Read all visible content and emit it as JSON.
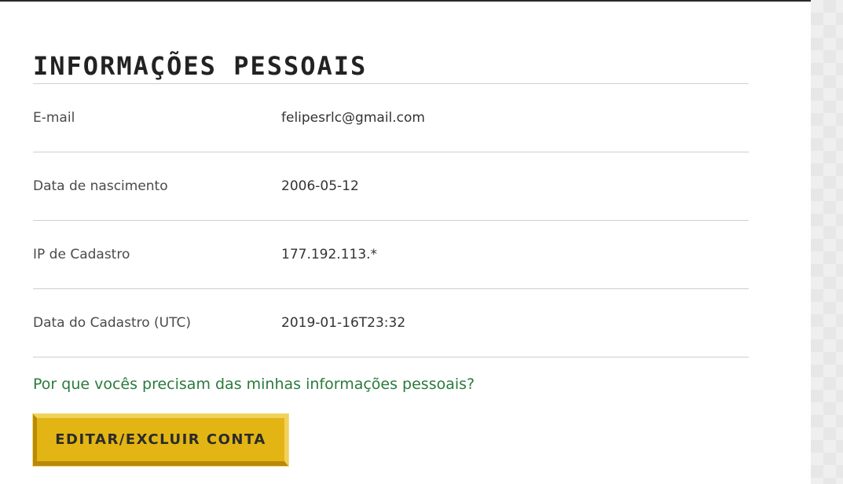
{
  "section": {
    "title": "Informações pessoais"
  },
  "info_rows": [
    {
      "label": "E-mail",
      "value": "felipesrlc@gmail.com"
    },
    {
      "label": "Data de nascimento",
      "value": "2006-05-12"
    },
    {
      "label": "IP de Cadastro",
      "value": "177.192.113.*"
    },
    {
      "label": "Data do Cadastro (UTC)",
      "value": "2019-01-16T23:32"
    }
  ],
  "why_link": {
    "text": "Por que vocês precisam das minhas informações pessoais?"
  },
  "edit_button": {
    "label": "EDITAR/EXCLUIR CONTA"
  },
  "colors": {
    "link": "#2a7a3c",
    "button": "#e3b514",
    "divider": "#cfcfcf"
  }
}
